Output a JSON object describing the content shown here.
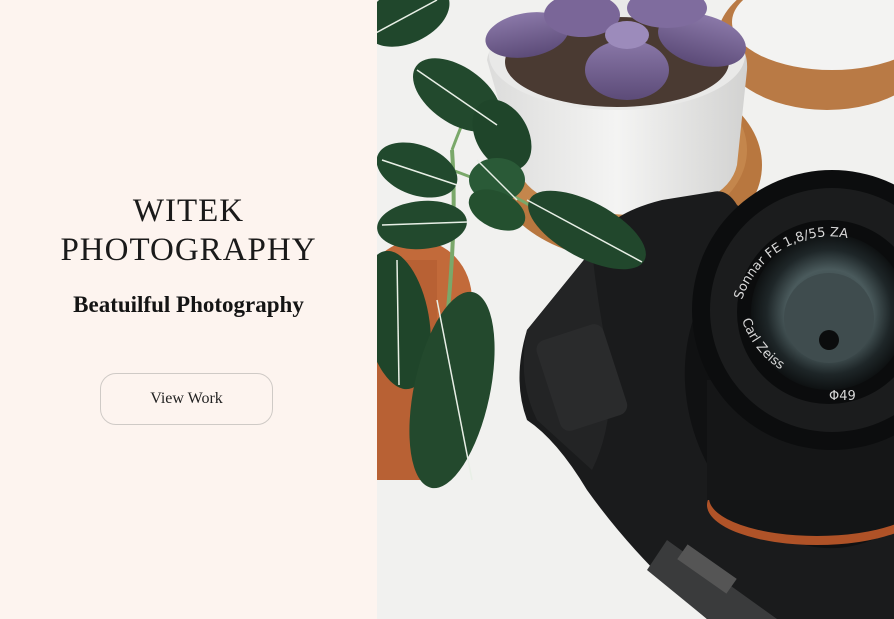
{
  "hero": {
    "title": "WITEK\nPHOTOGRAPHY",
    "tagline": "Beatuilful Photography",
    "cta_label": "View Work"
  },
  "photo": {
    "lens_text_top": "Sonnar FE 1,8/55 ZA",
    "lens_text_bottom": "Carl Zeiss",
    "lens_filter": "Φ49"
  },
  "colors": {
    "panel_background": "#fdf4ef",
    "text": "#1a1a1a",
    "button_border": "#cfcac6"
  }
}
